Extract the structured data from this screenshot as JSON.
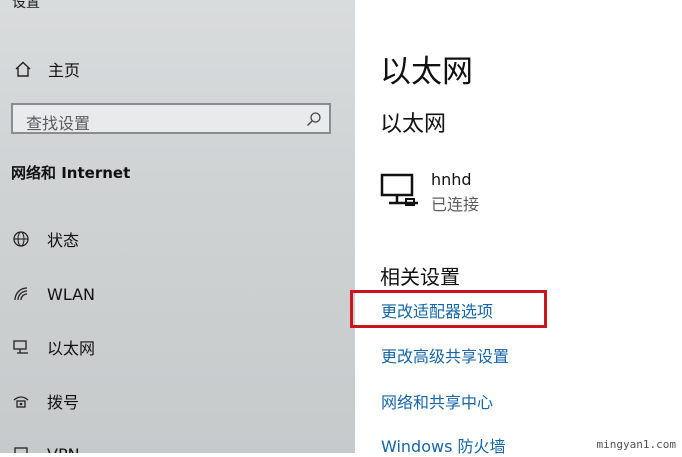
{
  "window": {
    "title": "设置"
  },
  "sidebar": {
    "home_label": "主页",
    "search_placeholder": "查找设置",
    "section_title": "网络和 Internet",
    "items": [
      {
        "label": "状态",
        "icon": "globe-icon"
      },
      {
        "label": "WLAN",
        "icon": "wifi-icon"
      },
      {
        "label": "以太网",
        "icon": "ethernet-icon"
      },
      {
        "label": "拨号",
        "icon": "dialup-icon"
      },
      {
        "label": "VPN",
        "icon": "vpn-icon"
      }
    ]
  },
  "main": {
    "page_title": "以太网",
    "subtitle": "以太网",
    "network": {
      "name": "hnhd",
      "status": "已连接",
      "icon": "ethernet-monitor-icon"
    },
    "related_title": "相关设置",
    "links": [
      {
        "label": "更改适配器选项",
        "highlighted": true
      },
      {
        "label": "更改高级共享设置"
      },
      {
        "label": "网络和共享中心"
      },
      {
        "label": "Windows 防火墙"
      }
    ]
  },
  "highlight_color": "#c9161e",
  "link_color": "#1565a8",
  "watermark": "mingyan1.com"
}
